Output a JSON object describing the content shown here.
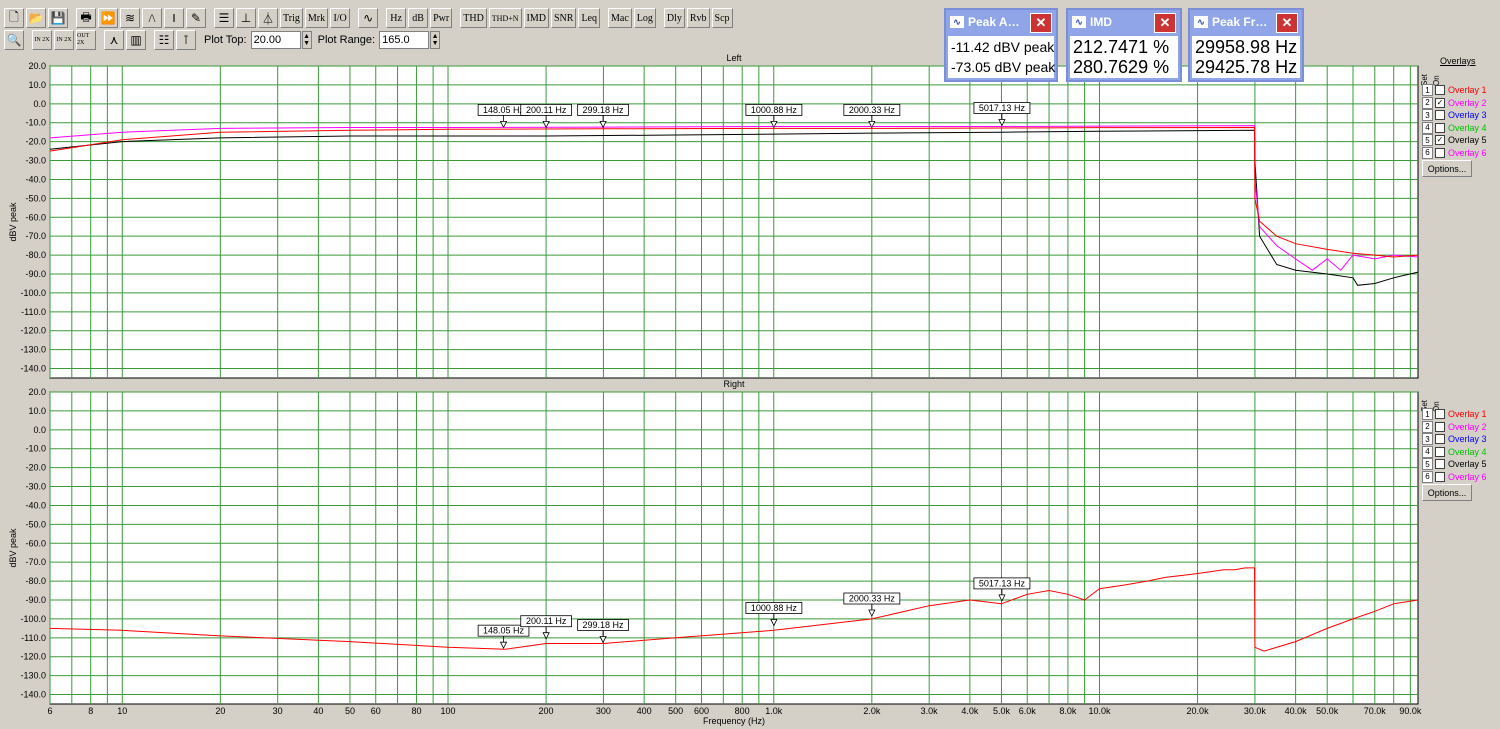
{
  "toolbar1": [
    {
      "name": "new-file-icon",
      "glyph": "🗋"
    },
    {
      "name": "open-folder-icon",
      "glyph": "📂"
    },
    {
      "name": "save-icon",
      "glyph": "💾"
    },
    {
      "gap": true
    },
    {
      "name": "print-icon",
      "glyph": "🖶"
    },
    {
      "name": "sweep-icon",
      "glyph": "⏩"
    },
    {
      "name": "generator-icon",
      "glyph": "≋"
    },
    {
      "name": "waveform-icon",
      "glyph": "/\\"
    },
    {
      "name": "bars-icon",
      "glyph": "‖"
    },
    {
      "name": "calibration-icon",
      "glyph": "✎"
    },
    {
      "gap": true
    },
    {
      "name": "list-icon",
      "glyph": "☰"
    },
    {
      "name": "spectrum-icon",
      "glyph": "⊥"
    },
    {
      "name": "scope-icon",
      "glyph": "⏃"
    },
    {
      "label": "Trig"
    },
    {
      "label": "Mrk"
    },
    {
      "label": "I/O"
    },
    {
      "gap": true
    },
    {
      "name": "sine-icon",
      "glyph": "∿"
    },
    {
      "gap": true
    },
    {
      "label": "Hz"
    },
    {
      "label": "dB"
    },
    {
      "label": "Pwr"
    },
    {
      "gap": true
    },
    {
      "label": "THD"
    },
    {
      "label": "THD+N"
    },
    {
      "label": "IMD"
    },
    {
      "label": "SNR"
    },
    {
      "label": "Leq"
    },
    {
      "gap": true
    },
    {
      "label": "Mac"
    },
    {
      "label": "Log"
    },
    {
      "gap": true
    },
    {
      "label": "Dly"
    },
    {
      "label": "Rvb"
    },
    {
      "label": "Scp"
    }
  ],
  "toolbar2": {
    "icons": [
      {
        "name": "zoom-icon",
        "glyph": "🔍"
      },
      {
        "name": "zoom-in-2x-icon",
        "glyph": "IN 2X"
      },
      {
        "name": "zoom-in-2x-disabled-icon",
        "glyph": "IN 2X"
      },
      {
        "name": "zoom-out-2x-icon",
        "glyph": "OUT 2X"
      },
      {
        "name": "peak-icon",
        "glyph": "⋏"
      },
      {
        "name": "histogram-icon",
        "glyph": "▥"
      },
      {
        "name": "table-icon",
        "glyph": "☷"
      },
      {
        "name": "cursor-icon",
        "glyph": "⊺"
      }
    ],
    "plot_top_label": "Plot Top:",
    "plot_top_value": "20.00",
    "plot_range_label": "Plot Range:",
    "plot_range_value": "165.0"
  },
  "panels": [
    {
      "title": "Peak A…",
      "lines": [
        "-11.42 dBV peak",
        "-73.05 dBV peak"
      ]
    },
    {
      "title": "IMD",
      "lines": [
        "212.7471 %",
        "280.7629 %"
      ]
    },
    {
      "title": "Peak Fr…",
      "lines": [
        "29958.98 Hz",
        "29425.78 Hz"
      ]
    }
  ],
  "overlays": {
    "title": "Overlays",
    "set_label": "Set",
    "on_label": "On",
    "options_label": "Options...",
    "items": [
      {
        "num": "1",
        "label": "Overlay 1",
        "color": "#ff0000"
      },
      {
        "num": "2",
        "label": "Overlay 2",
        "color": "#ff00ff"
      },
      {
        "num": "3",
        "label": "Overlay 3",
        "color": "#0000ff"
      },
      {
        "num": "4",
        "label": "Overlay 4",
        "color": "#00c000"
      },
      {
        "num": "5",
        "label": "Overlay 5",
        "color": "#000000"
      },
      {
        "num": "6",
        "label": "Overlay 6",
        "color": "#ff00ff"
      }
    ],
    "left_checked": [
      false,
      true,
      false,
      false,
      true,
      false
    ],
    "right_checked": [
      false,
      false,
      false,
      false,
      false,
      false
    ]
  },
  "chart_data": {
    "type": "line",
    "xlabel": "Frequency (Hz)",
    "ylabel": "dBV peak",
    "x_scale": "log",
    "xlim": [
      6,
      95000
    ],
    "ylim": [
      -145,
      20
    ],
    "y_ticks": [
      "20.0",
      "10.0",
      "0.0",
      "-10.0",
      "-20.0",
      "-30.0",
      "-40.0",
      "-50.0",
      "-60.0",
      "-70.0",
      "-80.0",
      "-90.0",
      "-100.0",
      "-110.0",
      "-120.0",
      "-130.0",
      "-140.0"
    ],
    "x_ticks": [
      {
        "v": 6,
        "l": "6"
      },
      {
        "v": 8,
        "l": "8"
      },
      {
        "v": 10,
        "l": "10"
      },
      {
        "v": 20,
        "l": "20"
      },
      {
        "v": 30,
        "l": "30"
      },
      {
        "v": 40,
        "l": "40"
      },
      {
        "v": 50,
        "l": "50"
      },
      {
        "v": 60,
        "l": "60"
      },
      {
        "v": 80,
        "l": "80"
      },
      {
        "v": 100,
        "l": "100"
      },
      {
        "v": 200,
        "l": "200"
      },
      {
        "v": 300,
        "l": "300"
      },
      {
        "v": 400,
        "l": "400"
      },
      {
        "v": 500,
        "l": "500"
      },
      {
        "v": 600,
        "l": "600"
      },
      {
        "v": 800,
        "l": "800"
      },
      {
        "v": 1000,
        "l": "1.0k"
      },
      {
        "v": 2000,
        "l": "2.0k"
      },
      {
        "v": 3000,
        "l": "3.0k"
      },
      {
        "v": 4000,
        "l": "4.0k"
      },
      {
        "v": 5000,
        "l": "5.0k"
      },
      {
        "v": 6000,
        "l": "6.0k"
      },
      {
        "v": 8000,
        "l": "8.0k"
      },
      {
        "v": 10000,
        "l": "10.0k"
      },
      {
        "v": 20000,
        "l": "20.0k"
      },
      {
        "v": 30000,
        "l": "30.0k"
      },
      {
        "v": 40000,
        "l": "40.0k"
      },
      {
        "v": 50000,
        "l": "50.0k"
      },
      {
        "v": 70000,
        "l": "70.0k"
      },
      {
        "v": 90000,
        "l": "90.0k"
      }
    ],
    "grid": true,
    "charts": [
      {
        "title": "Left",
        "markers": [
          {
            "label": "148.05 Hz",
            "f": 148.05,
            "db": -13
          },
          {
            "label": "200.11 Hz",
            "f": 200.11,
            "db": -13
          },
          {
            "label": "299.18 Hz",
            "f": 299.18,
            "db": -13
          },
          {
            "label": "1000.88 Hz",
            "f": 1000.88,
            "db": -13
          },
          {
            "label": "2000.33 Hz",
            "f": 2000.33,
            "db": -13
          },
          {
            "label": "5017.13 Hz",
            "f": 5017.13,
            "db": -12
          }
        ],
        "series": [
          {
            "color": "#000000",
            "points": [
              [
                6,
                -24
              ],
              [
                10,
                -20
              ],
              [
                20,
                -18
              ],
              [
                50,
                -17
              ],
              [
                100,
                -17
              ],
              [
                200,
                -17
              ],
              [
                500,
                -16.5
              ],
              [
                1000,
                -16
              ],
              [
                2000,
                -15.5
              ],
              [
                5000,
                -15
              ],
              [
                10000,
                -14.5
              ],
              [
                29900,
                -14
              ],
              [
                30000,
                -30
              ],
              [
                31000,
                -70
              ],
              [
                35000,
                -85
              ],
              [
                40000,
                -88
              ],
              [
                50000,
                -90
              ],
              [
                60000,
                -92
              ],
              [
                62000,
                -96
              ],
              [
                70000,
                -95
              ],
              [
                80000,
                -92
              ],
              [
                95000,
                -89
              ]
            ]
          },
          {
            "color": "#ff00ff",
            "points": [
              [
                6,
                -18
              ],
              [
                10,
                -15
              ],
              [
                20,
                -13
              ],
              [
                50,
                -12.5
              ],
              [
                100,
                -12.5
              ],
              [
                300,
                -12.3
              ],
              [
                1000,
                -12
              ],
              [
                2000,
                -12
              ],
              [
                5000,
                -12
              ],
              [
                10000,
                -11.8
              ],
              [
                29900,
                -11.5
              ],
              [
                30000,
                -40
              ],
              [
                31000,
                -65
              ],
              [
                35000,
                -75
              ],
              [
                40000,
                -82
              ],
              [
                45000,
                -88
              ],
              [
                50000,
                -82
              ],
              [
                55000,
                -88
              ],
              [
                60000,
                -80
              ],
              [
                70000,
                -82
              ],
              [
                80000,
                -80
              ],
              [
                95000,
                -81
              ]
            ]
          },
          {
            "color": "#ff0000",
            "points": [
              [
                6,
                -25
              ],
              [
                10,
                -19
              ],
              [
                20,
                -15
              ],
              [
                50,
                -14
              ],
              [
                100,
                -13.5
              ],
              [
                300,
                -13.2
              ],
              [
                1000,
                -13
              ],
              [
                2000,
                -13
              ],
              [
                5000,
                -12.8
              ],
              [
                10000,
                -12.6
              ],
              [
                29900,
                -12.5
              ],
              [
                30000,
                -50
              ],
              [
                31000,
                -62
              ],
              [
                35000,
                -70
              ],
              [
                40000,
                -74
              ],
              [
                50000,
                -77
              ],
              [
                60000,
                -79
              ],
              [
                70000,
                -80
              ],
              [
                80000,
                -81
              ],
              [
                95000,
                -80
              ]
            ]
          }
        ]
      },
      {
        "title": "Right",
        "markers": [
          {
            "label": "148.05 Hz",
            "f": 148.05,
            "db": -116
          },
          {
            "label": "200.11 Hz",
            "f": 200.11,
            "db": -111
          },
          {
            "label": "299.18 Hz",
            "f": 299.18,
            "db": -113
          },
          {
            "label": "1000.88 Hz",
            "f": 1000.88,
            "db": -104
          },
          {
            "label": "2000.33 Hz",
            "f": 2000.33,
            "db": -99
          },
          {
            "label": "5017.13 Hz",
            "f": 5017.13,
            "db": -91
          }
        ],
        "series": [
          {
            "color": "#ff0000",
            "points": [
              [
                6,
                -105
              ],
              [
                10,
                -106
              ],
              [
                20,
                -109
              ],
              [
                50,
                -112
              ],
              [
                100,
                -115
              ],
              [
                150,
                -116
              ],
              [
                200,
                -113
              ],
              [
                300,
                -113
              ],
              [
                500,
                -110
              ],
              [
                1000,
                -106
              ],
              [
                2000,
                -100
              ],
              [
                3000,
                -93
              ],
              [
                4000,
                -90
              ],
              [
                5000,
                -92
              ],
              [
                6000,
                -87
              ],
              [
                7000,
                -85
              ],
              [
                8000,
                -87
              ],
              [
                9000,
                -90
              ],
              [
                10000,
                -84
              ],
              [
                12000,
                -82
              ],
              [
                14000,
                -80
              ],
              [
                16000,
                -78
              ],
              [
                18000,
                -77
              ],
              [
                20000,
                -76
              ],
              [
                22000,
                -75
              ],
              [
                24000,
                -74
              ],
              [
                26000,
                -74
              ],
              [
                28000,
                -73
              ],
              [
                29900,
                -73
              ],
              [
                30000,
                -115
              ],
              [
                32000,
                -117
              ],
              [
                40000,
                -112
              ],
              [
                50000,
                -105
              ],
              [
                60000,
                -100
              ],
              [
                70000,
                -96
              ],
              [
                80000,
                -92
              ],
              [
                95000,
                -90
              ]
            ]
          }
        ]
      }
    ]
  }
}
